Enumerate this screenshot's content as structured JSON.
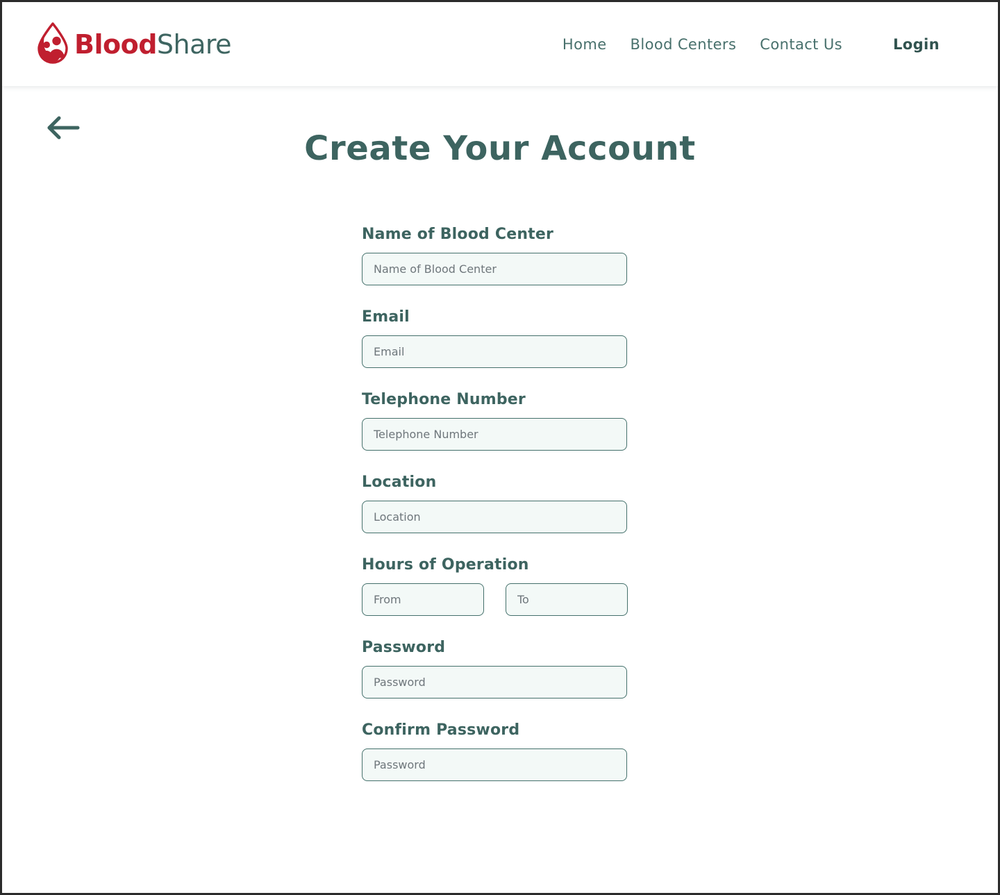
{
  "header": {
    "brand": {
      "icon": "blood-drop-people-icon",
      "text_primary": "Blood",
      "text_secondary": "Share",
      "color_primary": "#c01f2f",
      "color_secondary": "#3e6561"
    },
    "nav_items": [
      {
        "label": "Home",
        "name": "home"
      },
      {
        "label": "Blood Centers",
        "name": "blood-centers"
      },
      {
        "label": "Contact Us",
        "name": "contact-us"
      }
    ],
    "cta": {
      "label": "Login",
      "name": "login"
    }
  },
  "page": {
    "back_icon": "arrow-left-icon",
    "title": "Create Your Account"
  },
  "form": {
    "fields": [
      {
        "label": "Name of Blood Center",
        "placeholder": "Name of Blood Center",
        "value": "",
        "type": "text",
        "name": "blood-center-name"
      },
      {
        "label": "Email",
        "placeholder": "Email",
        "value": "",
        "type": "email",
        "name": "email"
      },
      {
        "label": "Telephone Number",
        "placeholder": "Telephone Number",
        "value": "",
        "type": "tel",
        "name": "telephone"
      },
      {
        "label": "Location",
        "placeholder": "Location",
        "value": "",
        "type": "text",
        "name": "location"
      }
    ],
    "hours": {
      "label": "Hours of Operation",
      "from": {
        "placeholder": "From",
        "value": "",
        "name": "hours-from"
      },
      "to": {
        "placeholder": "To",
        "value": "",
        "name": "hours-to"
      }
    },
    "password": {
      "label": "Password",
      "placeholder": "Password",
      "value": "",
      "name": "password"
    },
    "confirm_password": {
      "label": "Confirm Password",
      "placeholder": "Password",
      "value": "",
      "name": "confirm-password"
    }
  },
  "theme": {
    "accent_red": "#c01f2f",
    "teal_dark": "#3d6460",
    "teal_nav": "#48706c",
    "input_bg": "#f3f9f7",
    "input_border": "#44706b",
    "placeholder": "#6e767b",
    "page_bg": "#ffffff"
  }
}
